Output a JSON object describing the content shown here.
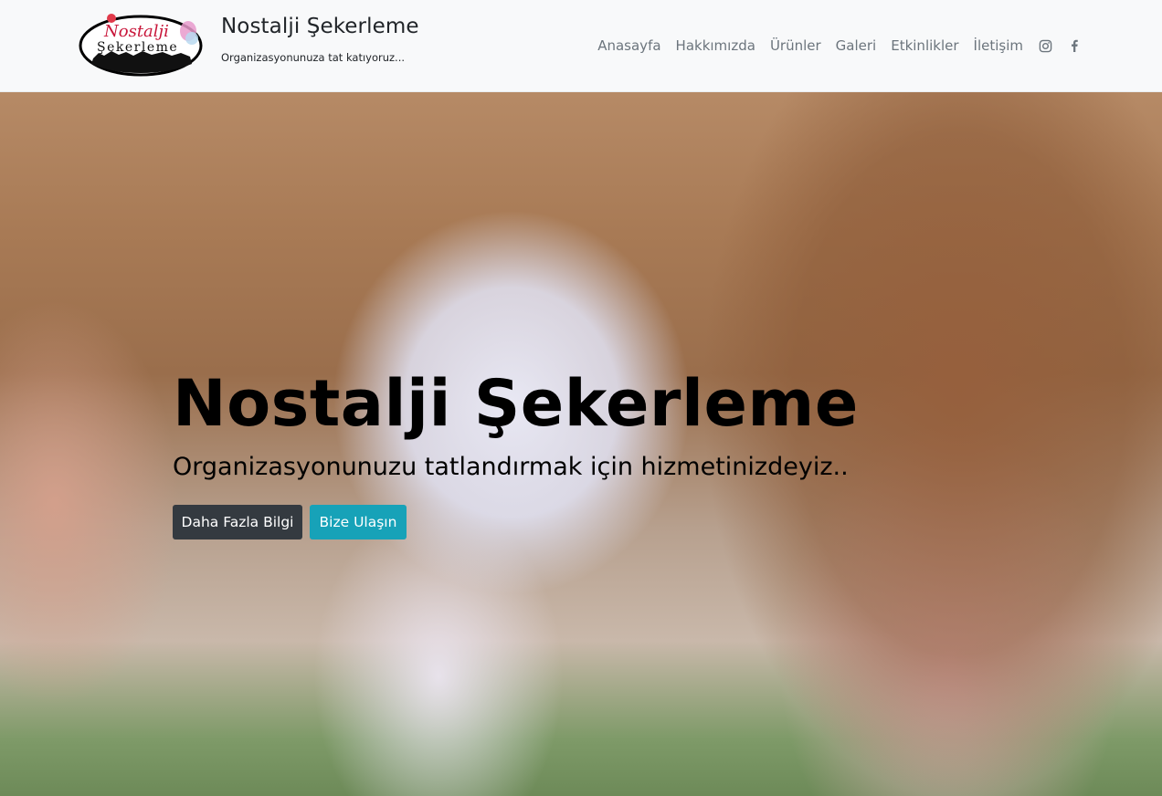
{
  "brand": {
    "logo_text_line1": "Nostalji",
    "logo_text_line2": "Şekerleme",
    "title": "Nostalji Şekerleme",
    "tagline": "Organizasyonunuza tat katıyoruz..."
  },
  "nav": {
    "items": [
      {
        "label": "Anasayfa"
      },
      {
        "label": "Hakkımızda"
      },
      {
        "label": "Ürünler"
      },
      {
        "label": "Galeri"
      },
      {
        "label": "Etkinlikler"
      },
      {
        "label": "İletişim"
      }
    ],
    "social": [
      {
        "icon": "instagram-icon"
      },
      {
        "icon": "facebook-icon"
      }
    ]
  },
  "hero": {
    "title": "Nostalji Şekerleme",
    "subtitle": "Organizasyonunuzu tatlandırmak için hizmetinizdeyiz..",
    "primary_button": "Daha Fazla Bilgi",
    "secondary_button": "Bize Ulaşın"
  },
  "colors": {
    "navbar_bg": "#f8f9fa",
    "nav_link": "#6c757d",
    "btn_dark": "#343a40",
    "btn_info": "#17a2b8"
  }
}
